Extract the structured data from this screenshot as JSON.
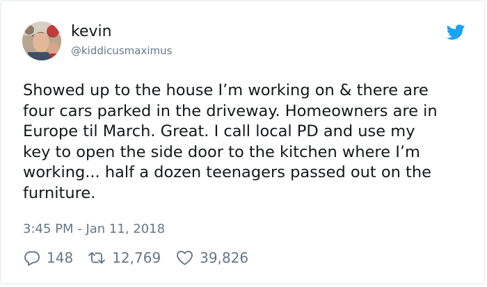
{
  "author": {
    "name": "kevin",
    "handle": "@kiddicusmaximus"
  },
  "tweet": {
    "text": "Showed up to the house I’m working on & there are\nfour cars parked in the driveway. Homeowners are in\nEurope til March. Great. I call local PD and use my\nkey to open the side door to the kitchen where I’m\nworking... half a dozen teenagers passed out on the\nfurniture.",
    "timestamp": "3:45 PM - Jan 11, 2018"
  },
  "stats": {
    "replies": "148",
    "retweets": "12,769",
    "likes": "39,826"
  },
  "icons": {
    "brand": "twitter-bird-icon",
    "reply": "reply-icon",
    "retweet": "retweet-icon",
    "like": "heart-icon"
  },
  "colors": {
    "brand_blue": "#1da1f2",
    "secondary_text": "#657786",
    "primary_text": "#14171a"
  }
}
